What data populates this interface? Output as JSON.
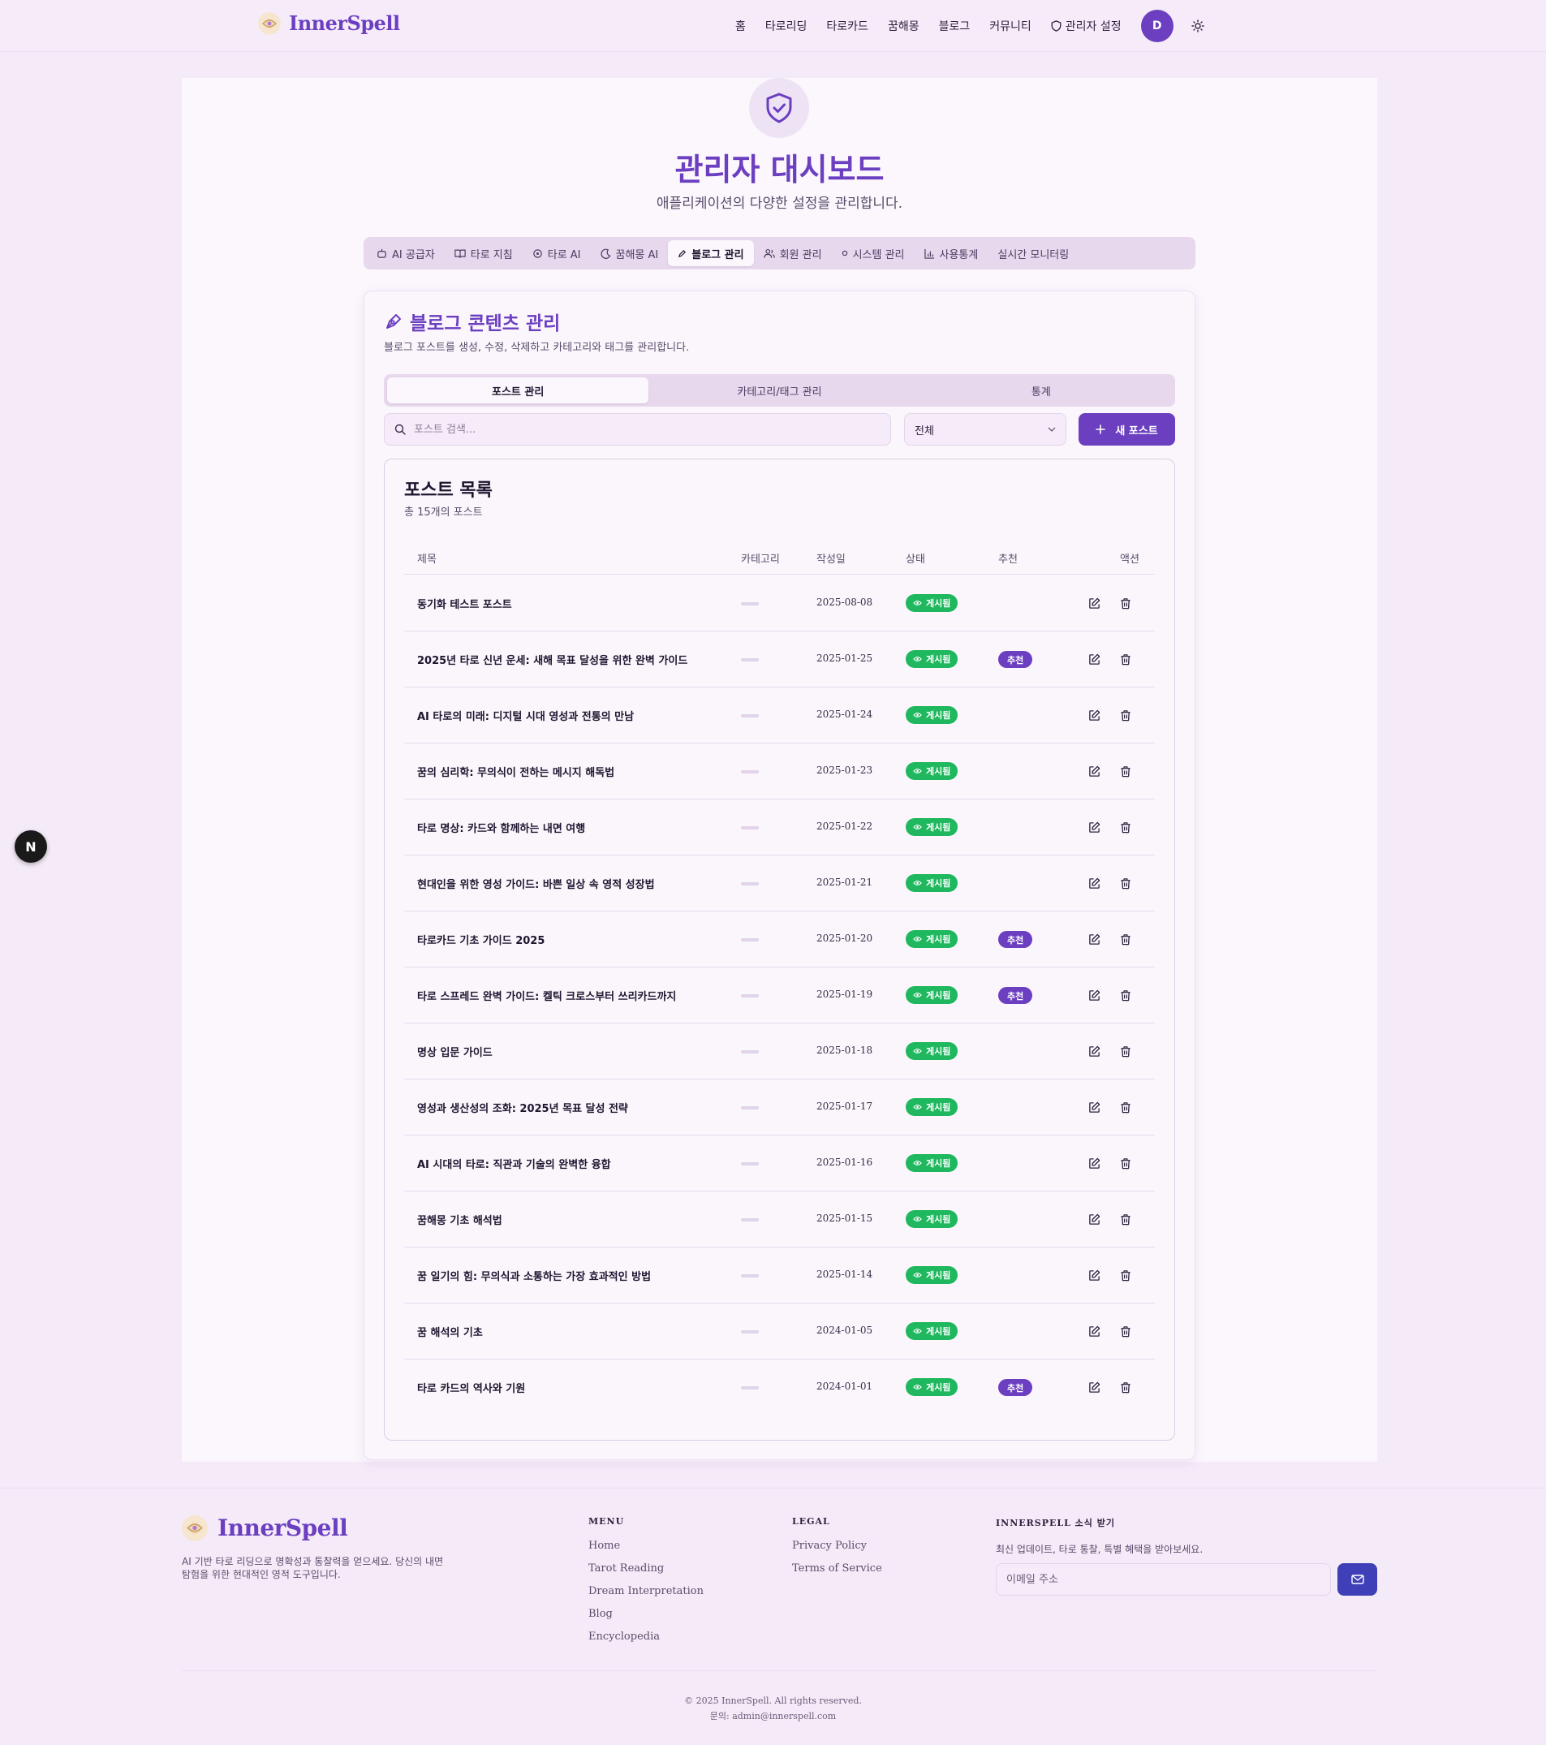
{
  "header": {
    "brand": "InnerSpell",
    "nav": [
      "홈",
      "타로리딩",
      "타로카드",
      "꿈해몽",
      "블로그",
      "커뮤니티"
    ],
    "admin_link": "관리자 설정",
    "avatar_initial": "D"
  },
  "page": {
    "title": "관리자 대시보드",
    "subtitle": "애플리케이션의 다양한 설정을 관리합니다.",
    "admin_tabs": [
      {
        "label": "AI 공급자",
        "icon": "robot-icon"
      },
      {
        "label": "타로 지침",
        "icon": "book-icon"
      },
      {
        "label": "타로 AI",
        "icon": "sparkle-icon"
      },
      {
        "label": "꿈해몽 AI",
        "icon": "moon-icon"
      },
      {
        "label": "블로그 관리",
        "icon": "pen-icon",
        "active": true
      },
      {
        "label": "회원 관리",
        "icon": "users-icon"
      },
      {
        "label": "시스템 관리",
        "icon": "dot-icon"
      },
      {
        "label": "사용통계",
        "icon": "bar-chart-icon"
      },
      {
        "label": "실시간 모니터링",
        "icon": ""
      }
    ]
  },
  "blog": {
    "title": "블로그 콘텐츠 관리",
    "subtitle": "블로그 포스트를 생성, 수정, 삭제하고 카테고리와 태그를 관리합니다.",
    "sub_tabs": [
      "포스트 관리",
      "카테고리/태그 관리",
      "통계"
    ],
    "search_placeholder": "포스트 검색...",
    "filter_value": "전체",
    "new_post_label": "새 포스트",
    "list_title": "포스트 목록",
    "list_count": "총 15개의 포스트",
    "columns": {
      "title": "제목",
      "category": "카테고리",
      "date": "작성일",
      "status": "상태",
      "featured": "추천",
      "actions": "액션"
    },
    "status_label": "게시됨",
    "featured_label": "추천",
    "posts": [
      {
        "title": "동기화 테스트 포스트",
        "date": "2025-08-08",
        "featured": false
      },
      {
        "title": "2025년 타로 신년 운세: 새해 목표 달성을 위한 완벽 가이드",
        "date": "2025-01-25",
        "featured": true
      },
      {
        "title": "AI 타로의 미래: 디지털 시대 영성과 전통의 만남",
        "date": "2025-01-24",
        "featured": false
      },
      {
        "title": "꿈의 심리학: 무의식이 전하는 메시지 해독법",
        "date": "2025-01-23",
        "featured": false
      },
      {
        "title": "타로 명상: 카드와 함께하는 내면 여행",
        "date": "2025-01-22",
        "featured": false
      },
      {
        "title": "현대인을 위한 영성 가이드: 바쁜 일상 속 영적 성장법",
        "date": "2025-01-21",
        "featured": false
      },
      {
        "title": "타로카드 기초 가이드 2025",
        "date": "2025-01-20",
        "featured": true
      },
      {
        "title": "타로 스프레드 완벽 가이드: 켈틱 크로스부터 쓰리카드까지",
        "date": "2025-01-19",
        "featured": true
      },
      {
        "title": "명상 입문 가이드",
        "date": "2025-01-18",
        "featured": false
      },
      {
        "title": "영성과 생산성의 조화: 2025년 목표 달성 전략",
        "date": "2025-01-17",
        "featured": false
      },
      {
        "title": "AI 시대의 타로: 직관과 기술의 완벽한 융합",
        "date": "2025-01-16",
        "featured": false
      },
      {
        "title": "꿈해몽 기초 해석법",
        "date": "2025-01-15",
        "featured": false
      },
      {
        "title": "꿈 일기의 힘: 무의식과 소통하는 가장 효과적인 방법",
        "date": "2025-01-14",
        "featured": false
      },
      {
        "title": "꿈 해석의 기초",
        "date": "2024-01-05",
        "featured": false
      },
      {
        "title": "타로 카드의 역사와 기원",
        "date": "2024-01-01",
        "featured": true
      }
    ]
  },
  "dev_badge": "N",
  "footer": {
    "brand": "InnerSpell",
    "description": "AI 기반 타로 리딩으로 명확성과 통찰력을 얻으세요. 당신의 내면 탐험을 위한 현대적인 영적 도구입니다.",
    "menu_head": "MENU",
    "menu": [
      "Home",
      "Tarot Reading",
      "Dream Interpretation",
      "Blog",
      "Encyclopedia"
    ],
    "legal_head": "LEGAL",
    "legal": [
      "Privacy Policy",
      "Terms of Service"
    ],
    "news_head": "INNERSPELL 소식 받기",
    "news_sub": "최신 업데이트, 타로 통찰, 특별 혜택을 받아보세요.",
    "email_placeholder": "이메일 주소",
    "copyright": "© 2025 InnerSpell. All rights reserved.",
    "contact": "문의: admin@innerspell.com"
  },
  "colors": {
    "accent": "#6b3fc0",
    "status_green": "#1fb85e",
    "background": "#f5ebf8"
  }
}
